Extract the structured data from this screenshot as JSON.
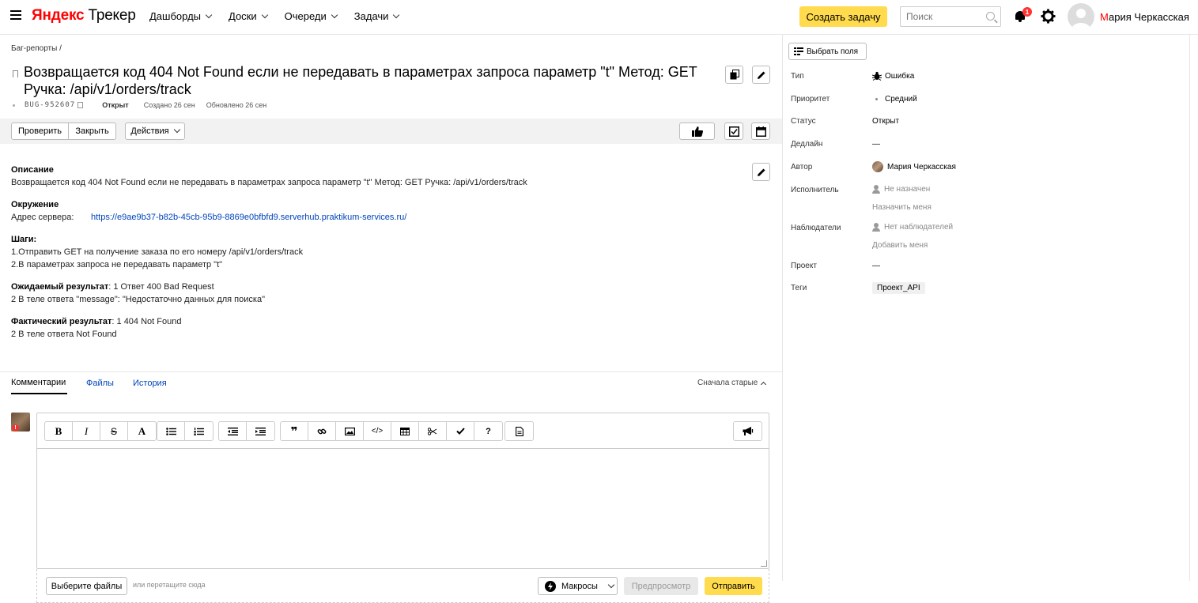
{
  "header": {
    "logo_brand": "Яндекс",
    "logo_product": "Трекер",
    "nav": [
      "Дашборды",
      "Доски",
      "Очереди",
      "Задачи"
    ],
    "create_label": "Создать задачу",
    "search_placeholder": "Поиск",
    "notifications_count": "1",
    "user_first": "М",
    "user_rest": "ария Черкасская"
  },
  "issue": {
    "breadcrumb": "Баг-репорты /",
    "title": "Возвращается код 404 Not Found если не передавать в параметрах запроса параметр \"t\" Метод: GET Ручка: /api/v1/orders/track",
    "key": "BUG-952607",
    "status": "Открыт",
    "created": "Создано 26 сен",
    "updated": "Обновлено 26 сен"
  },
  "actions": {
    "check": "Проверить",
    "close": "Закрыть",
    "actions": "Действия"
  },
  "description": {
    "h_desc": "Описание",
    "desc_text": "Возвращается код 404 Not Found если не передавать в параметрах запроса параметр \"t\" Метод: GET Ручка: /api/v1/orders/track",
    "h_env": "Окружение",
    "server_label": "Адрес сервера:",
    "server_url": "https://e9ae9b37-b82b-45cb-95b9-8869e0bfbfd9.serverhub.praktikum-services.ru/",
    "h_steps": "Шаги:",
    "step1": "1.Отправить GET на получение заказа по его номеру /api/v1/orders/track",
    "step2": "2.В параметрах запроса не передавать параметр \"t\"",
    "h_expected": "Ожидаемый результат",
    "expected1": ": 1 Ответ 400 Bad Request",
    "expected2": "2 В теле ответа \"message\": \"Недостаточно данных для поиска\"",
    "h_actual": "Фактический результат",
    "actual1": ": 1 404 Not Found",
    "actual2": "2 В теле ответа Not Found"
  },
  "tabs": {
    "comments": "Комментарии",
    "files": "Файлы",
    "history": "История",
    "sort": "Сначала старые"
  },
  "editor": {
    "bold": "B",
    "italic": "I",
    "strike": "S",
    "font": "A",
    "quote": "❞",
    "help": "?",
    "choose_files": "Выберите файлы",
    "drop_hint": "или перетащите сюда",
    "macros": "Макросы",
    "preview": "Предпросмотр",
    "send": "Отправить",
    "avatar_badge": "!"
  },
  "sidebar": {
    "select_fields": "Выбрать поля",
    "type_label": "Тип",
    "type_value": "Ошибка",
    "priority_label": "Приоритет",
    "priority_value": "Средний",
    "status_label": "Статус",
    "status_value": "Открыт",
    "deadline_label": "Дедлайн",
    "deadline_value": "—",
    "author_label": "Автор",
    "author_value": "Мария Черкасская",
    "assignee_label": "Исполнитель",
    "assignee_value": "Не назначен",
    "assign_me": "Назначить меня",
    "watchers_label": "Наблюдатели",
    "watchers_value": "Нет наблюдателей",
    "add_me": "Добавить меня",
    "project_label": "Проект",
    "project_value": "—",
    "tags_label": "Теги",
    "tag_value": "Проект_API"
  },
  "colors": {
    "accent": "#ffdb4d",
    "link": "#0044bb",
    "brand_red": "#ff0000"
  }
}
